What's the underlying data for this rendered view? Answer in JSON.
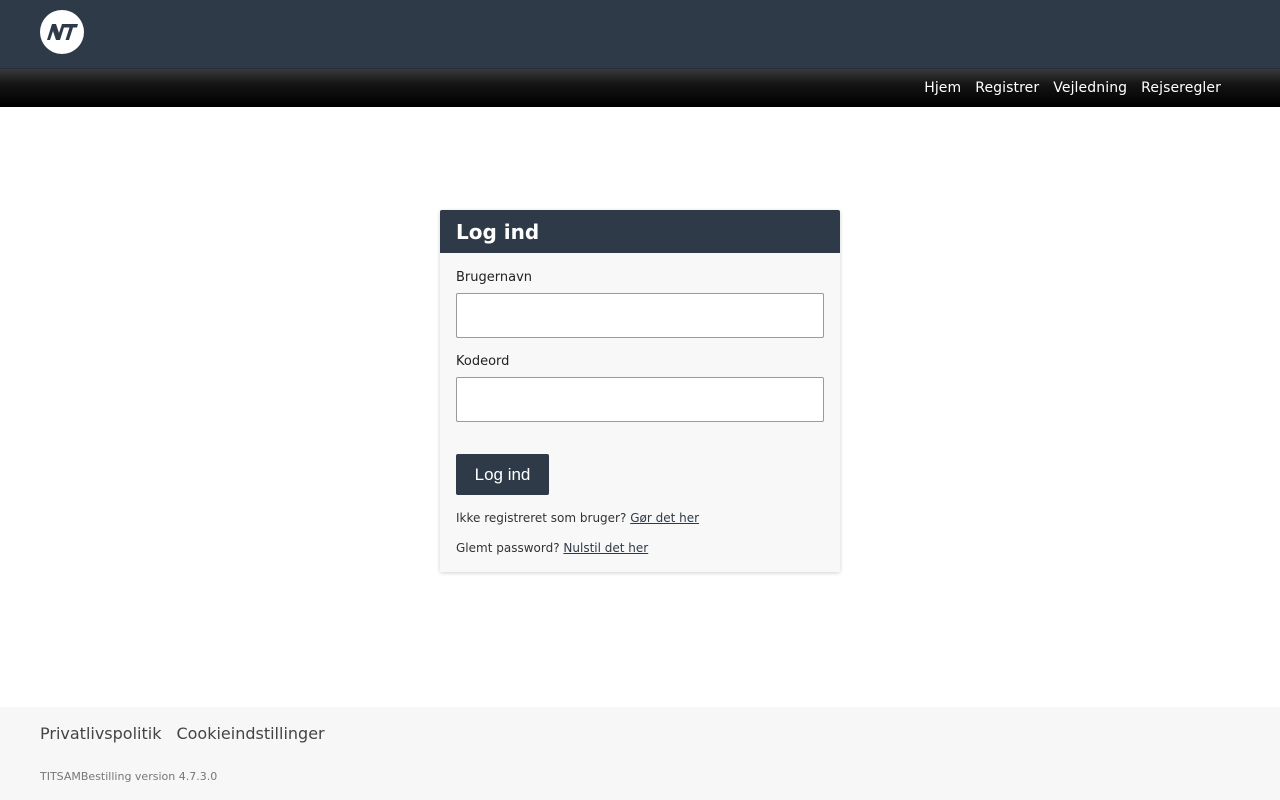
{
  "header": {
    "logo_text": "NT",
    "logo_icon": "nt-logo-icon"
  },
  "nav": {
    "items": [
      {
        "label": "Hjem"
      },
      {
        "label": "Registrer"
      },
      {
        "label": "Vejledning"
      },
      {
        "label": "Rejseregler"
      }
    ]
  },
  "login": {
    "title": "Log ind",
    "username_label": "Brugernavn",
    "username_value": "",
    "password_label": "Kodeord",
    "password_value": "",
    "submit_label": "Log ind",
    "register_prompt": "Ikke registreret som bruger?",
    "register_link": "Gør det her",
    "forgot_prompt": "Glemt password?",
    "forgot_link": "Nulstil det her"
  },
  "footer": {
    "links": [
      {
        "label": "Privatlivspolitik"
      },
      {
        "label": "Cookieindstillinger"
      }
    ],
    "version": "TITSAMBestilling version 4.7.3.0"
  },
  "colors": {
    "primary": "#2e3a48",
    "navbar": "#000000",
    "footer_bg": "#f7f7f7",
    "card_bg": "#f8f8f8"
  }
}
